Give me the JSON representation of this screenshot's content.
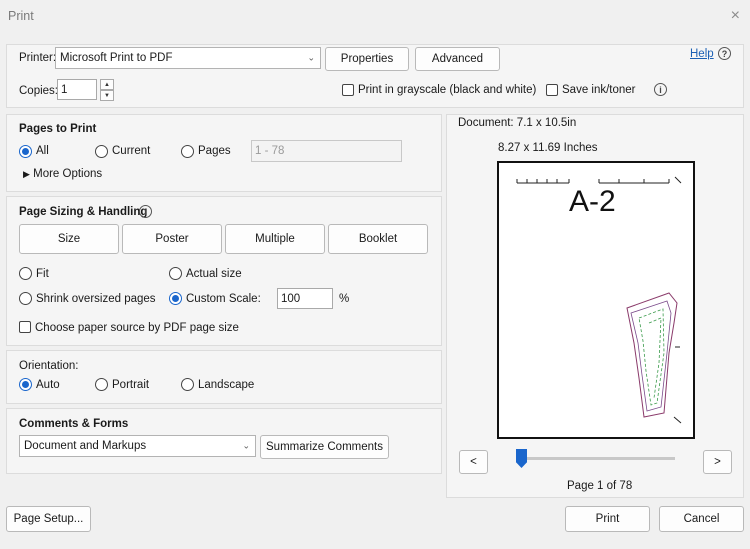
{
  "window": {
    "title": "Print",
    "close_icon": "×"
  },
  "printer": {
    "label": "Printer:",
    "value": "Microsoft Print to PDF",
    "properties_label": "Properties",
    "advanced_label": "Advanced",
    "help_label": "Help",
    "copies_label": "Copies:",
    "copies_value": "1",
    "grayscale_label": "Print in grayscale (black and white)",
    "save_ink_label": "Save ink/toner"
  },
  "pages_to_print": {
    "title": "Pages to Print",
    "all_label": "All",
    "current_label": "Current",
    "pages_label": "Pages",
    "pages_range": "1 - 78",
    "more_options": "More Options"
  },
  "sizing": {
    "title": "Page Sizing & Handling",
    "tabs": [
      "Size",
      "Poster",
      "Multiple",
      "Booklet"
    ],
    "fit_label": "Fit",
    "actual_label": "Actual size",
    "shrink_label": "Shrink oversized pages",
    "custom_label": "Custom Scale:",
    "custom_value": "100",
    "percent": "%",
    "paper_source_label": "Choose paper source by PDF page size"
  },
  "orientation": {
    "title": "Orientation:",
    "auto_label": "Auto",
    "portrait_label": "Portrait",
    "landscape_label": "Landscape"
  },
  "comments": {
    "title": "Comments & Forms",
    "value": "Document and Markups",
    "summarize_label": "Summarize Comments"
  },
  "preview": {
    "document_size": "Document: 7.1 x 10.5in",
    "paper_size": "8.27 x 11.69 Inches",
    "page_label": "A-2",
    "prev": "<",
    "next": ">",
    "page_status": "Page 1 of 78",
    "slider_position": 0
  },
  "footer": {
    "page_setup_label": "Page Setup...",
    "print_label": "Print",
    "cancel_label": "Cancel"
  },
  "colors": {
    "accent": "#1a66cc",
    "link": "#1a5fb4"
  }
}
